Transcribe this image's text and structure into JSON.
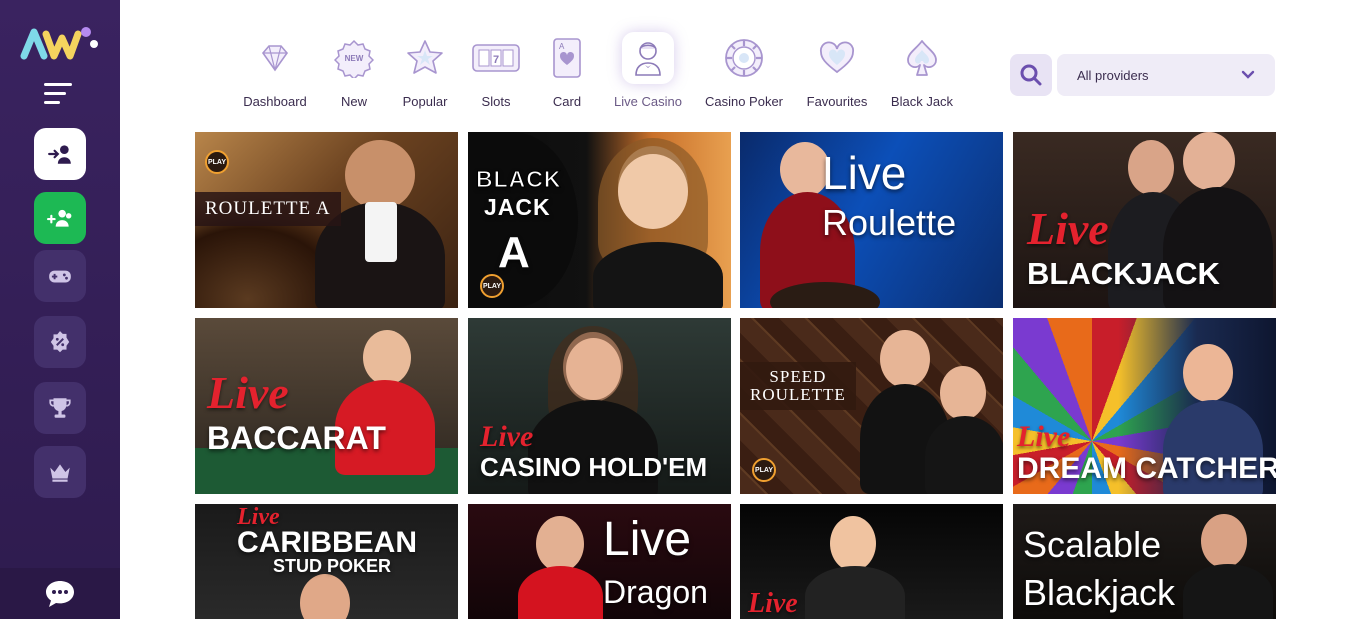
{
  "sidebar": {
    "logo_name": "AW-logo",
    "items": [
      {
        "name": "login-icon",
        "style": "white"
      },
      {
        "name": "register-icon",
        "style": "green"
      },
      {
        "name": "gamepad-icon",
        "style": "dark"
      },
      {
        "name": "promotions-icon",
        "style": "dark"
      },
      {
        "name": "trophy-icon",
        "style": "dark"
      },
      {
        "name": "crown-icon",
        "style": "dark"
      }
    ],
    "chat_icon": "chat-icon"
  },
  "categories": [
    {
      "label": "Dashboard",
      "icon": "diamond-icon",
      "active": false
    },
    {
      "label": "New",
      "icon": "new-badge-icon",
      "active": false
    },
    {
      "label": "Popular",
      "icon": "star-icon",
      "active": false
    },
    {
      "label": "Slots",
      "icon": "slot-777-icon",
      "active": false
    },
    {
      "label": "Card",
      "icon": "playing-card-icon",
      "active": false
    },
    {
      "label": "Live Casino",
      "icon": "dealer-icon",
      "active": true
    },
    {
      "label": "Casino Poker",
      "icon": "poker-chip-icon",
      "active": false
    },
    {
      "label": "Favourites",
      "icon": "heart-icon",
      "active": false
    },
    {
      "label": "Black Jack",
      "icon": "spade-icon",
      "active": false
    }
  ],
  "search": {
    "icon": "search-icon"
  },
  "provider_filter": {
    "selected": "All providers",
    "icon": "chevron-down-icon"
  },
  "games": [
    {
      "name": "game-roulette-a",
      "title": "ROULETTE A",
      "provider_badge": "PLAY"
    },
    {
      "name": "game-blackjack-a",
      "title_line1": "BLACK",
      "title_line2": "JACK",
      "title_line3": "A",
      "provider_badge": "PLAY"
    },
    {
      "name": "game-live-roulette",
      "live": "Live",
      "title": "Roulette"
    },
    {
      "name": "game-live-blackjack",
      "live": "Live",
      "title": "BLACKJACK"
    },
    {
      "name": "game-live-baccarat",
      "live": "Live",
      "title": "BACCARAT"
    },
    {
      "name": "game-live-casino-holdem",
      "live": "Live",
      "title": "CASINO HOLD'EM"
    },
    {
      "name": "game-speed-roulette",
      "title_line1": "SPEED",
      "title_line2": "ROULETTE",
      "provider_badge": "PLAY"
    },
    {
      "name": "game-live-dream-catcher",
      "live": "Live",
      "title": "DREAM CATCHER"
    },
    {
      "name": "game-live-caribbean-stud",
      "live": "Live",
      "title": "CARIBBEAN",
      "subtitle": "STUD POKER"
    },
    {
      "name": "game-live-dragon-tiger",
      "live_line": "Live",
      "title": "Dragon"
    },
    {
      "name": "game-live-generic",
      "live": "Live"
    },
    {
      "name": "game-scalable-blackjack",
      "title_line1": "Scalable",
      "title_line2": "Blackjack"
    }
  ],
  "colors": {
    "sidebar": "#2e1b4e",
    "accent": "#8c7ab8",
    "green": "#1db954",
    "live_red": "#e4222e"
  }
}
